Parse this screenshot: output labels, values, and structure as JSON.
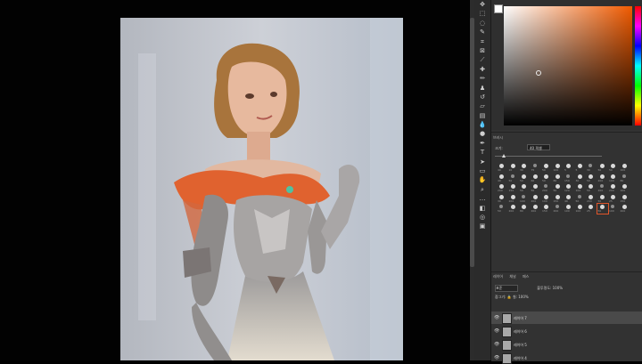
{
  "brush_panel": {
    "tab": "브러시",
    "size_label": "크기:",
    "size_value": "40 픽셀",
    "brush_numbers": [
      "40",
      "10",
      "30",
      "75",
      "50",
      "100",
      "5",
      "5",
      "30",
      "50",
      "50",
      "100",
      "40",
      "50",
      "50",
      "60",
      "50",
      "80",
      "150",
      "30",
      "50",
      "200",
      "100",
      "80",
      "200",
      "150",
      "50",
      "50",
      "200",
      "50",
      "120",
      "100",
      "50",
      "200",
      "200",
      "100",
      "30",
      "200",
      "100",
      "200",
      "100",
      "150",
      "40",
      "50",
      "200",
      "50",
      "25",
      "150",
      "50",
      "200",
      "80",
      "200",
      "150",
      "200",
      "100",
      "100",
      "25",
      "50",
      "100",
      "200"
    ]
  },
  "layers_panel": {
    "tabs": [
      "레이어",
      "채널",
      "패스"
    ],
    "blend_mode": "표준",
    "opacity_label": "불투명도:",
    "opacity_value": "100%",
    "lock_label": "잠그기:",
    "fill_label": "칠:",
    "fill_value": "100%",
    "layers": [
      {
        "name": "레이어 7"
      },
      {
        "name": "레이어 6"
      },
      {
        "name": "레이어 5"
      },
      {
        "name": "레이어 4"
      }
    ]
  },
  "colors": {
    "accent": "#f05a00",
    "selected_brush_outline": "#e0552a"
  }
}
